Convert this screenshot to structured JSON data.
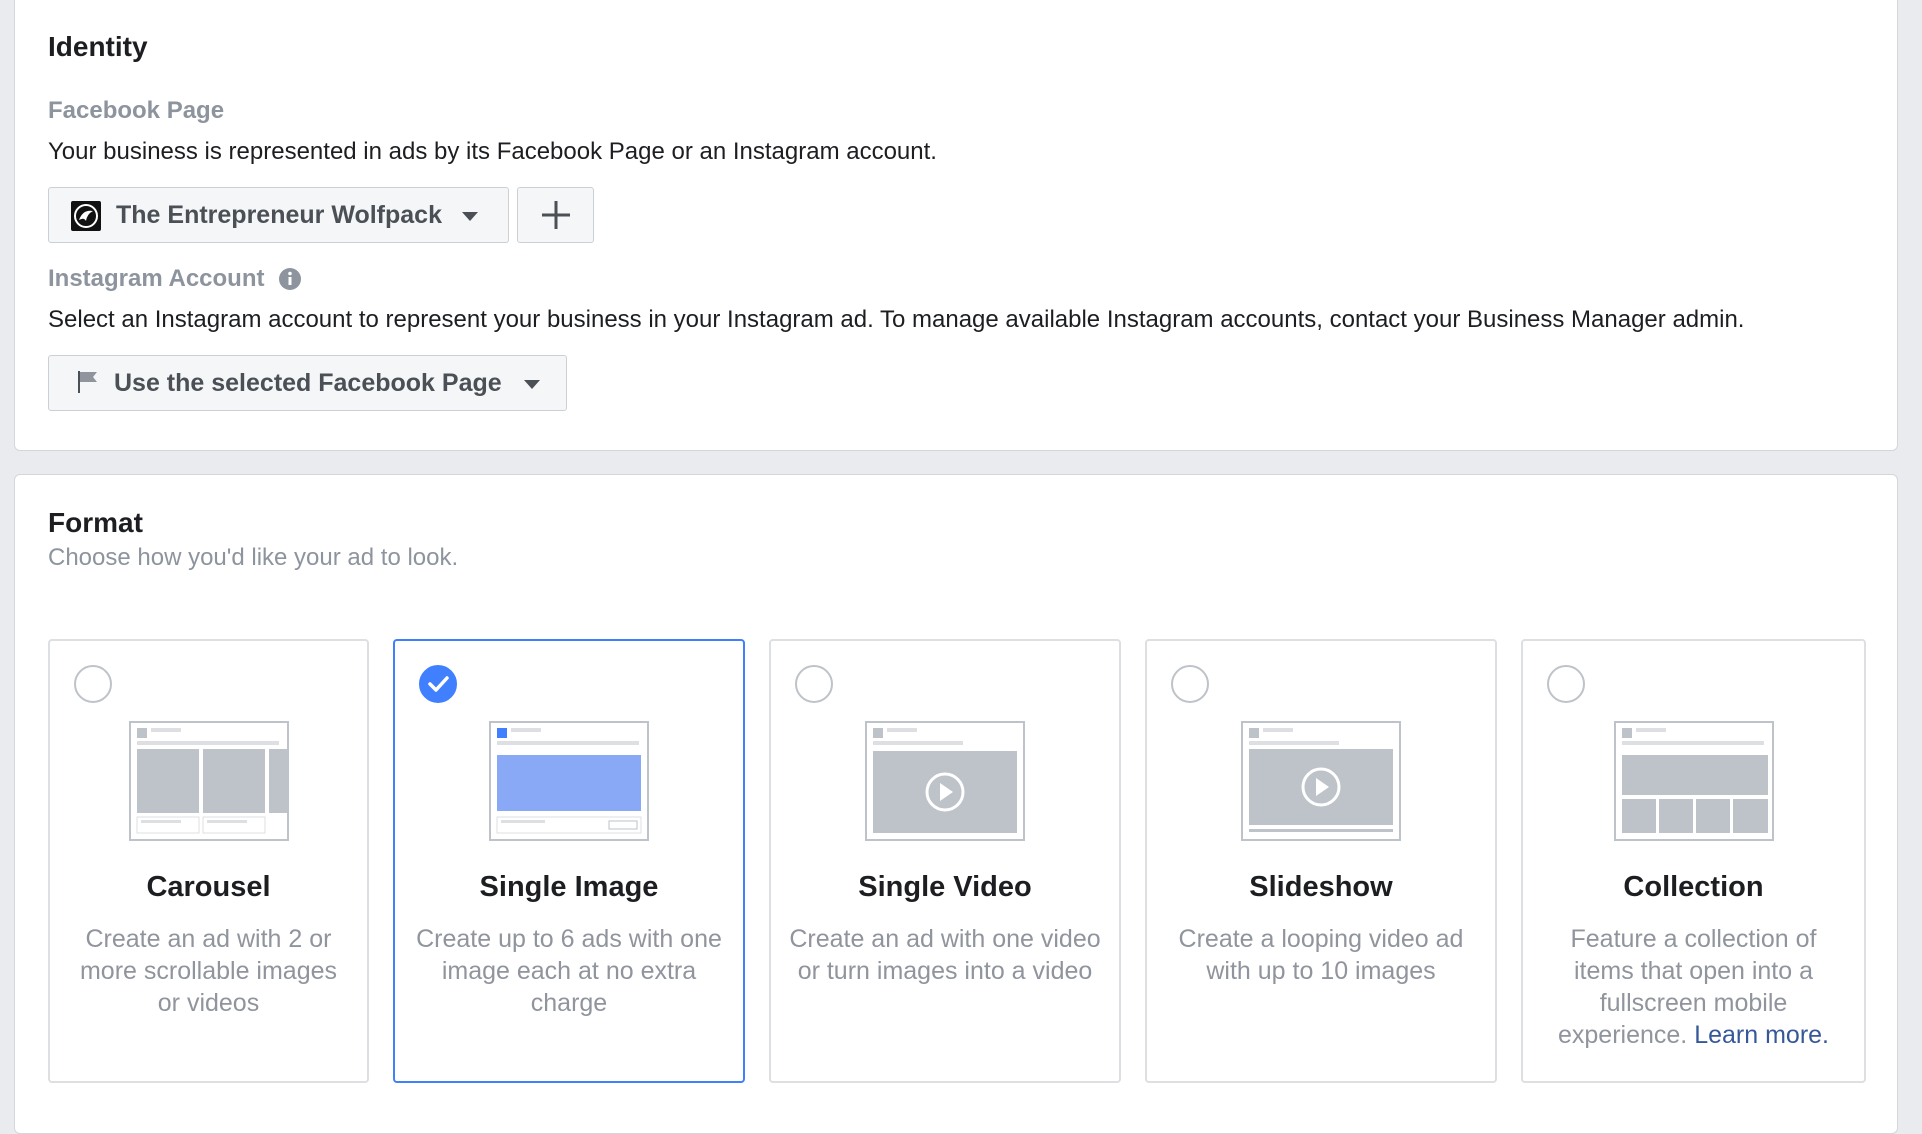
{
  "identity": {
    "title": "Identity",
    "facebook_page": {
      "label": "Facebook Page",
      "description": "Your business is represented in ads by its Facebook Page or an Instagram account.",
      "selected_page": "The Entrepreneur Wolfpack",
      "add_icon": "plus-icon"
    },
    "instagram": {
      "label": "Instagram Account",
      "info_icon": "info-icon",
      "description": "Select an Instagram account to represent your business in your Instagram ad. To manage available Instagram accounts, contact your Business Manager admin.",
      "selected_option": "Use the selected Facebook Page",
      "option_icon": "flag-icon"
    }
  },
  "format": {
    "title": "Format",
    "subtitle": "Choose how you'd like your ad to look.",
    "selected": "Single Image",
    "cards": [
      {
        "title": "Carousel",
        "desc": "Create an ad with 2 or more scrollable images or videos",
        "selected": false
      },
      {
        "title": "Single Image",
        "desc": "Create up to 6 ads with one image each at no extra charge",
        "selected": true
      },
      {
        "title": "Single Video",
        "desc": "Create an ad with one video or turn images into a video",
        "selected": false
      },
      {
        "title": "Slideshow",
        "desc": "Create a looping video ad with up to 10 images",
        "selected": false
      },
      {
        "title": "Collection",
        "desc": "Feature a collection of items that open into a fullscreen mobile experience.",
        "link": "Learn more.",
        "selected": false
      }
    ]
  },
  "colors": {
    "accent": "#4080ff",
    "link": "#365899",
    "muted": "#90949c",
    "border": "#dddfe2"
  }
}
